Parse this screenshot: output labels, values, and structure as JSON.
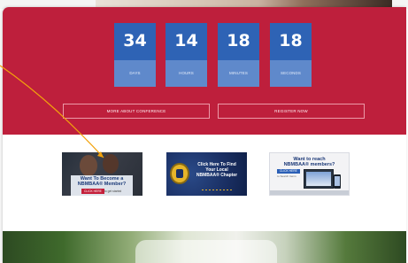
{
  "countdown": [
    {
      "value": "34",
      "label": "DAYS"
    },
    {
      "value": "14",
      "label": "HOURS"
    },
    {
      "value": "18",
      "label": "MINUTES"
    },
    {
      "value": "18",
      "label": "SECONDS"
    }
  ],
  "buttons": {
    "more_about": "MORE ABOUT CONFERENCE",
    "register": "REGISTER NOW"
  },
  "ads": {
    "member": {
      "line1": "Want To Become a",
      "line2": "NBMBAA® Member?",
      "cta": "CLICK HERE",
      "sub": "to get started"
    },
    "chapter": {
      "line1": "Click Here To Find",
      "line2": "Your Local",
      "line3": "NBMBAA® Chapter"
    },
    "reach": {
      "line1": "Want to reach",
      "line2": "NBMBAA® members?",
      "cta": "CLICK HERE",
      "sub": "to Search Items"
    }
  },
  "colors": {
    "banner": "#be1f3c",
    "countdown_box": "#2e63b5",
    "countdown_label_strip": "#5f89cb",
    "annotation_arrow": "#f2a20c"
  }
}
